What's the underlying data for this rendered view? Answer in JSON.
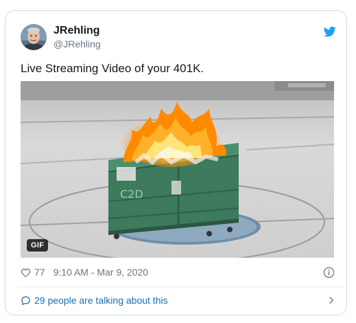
{
  "tweet": {
    "author": {
      "display_name": "JRehling",
      "handle": "@JRehling",
      "avatar_icon": "avatar"
    },
    "text": "Live Streaming Video of your 401K.",
    "media": {
      "type": "gif",
      "badge": "GIF",
      "subject": "dumpster-fire",
      "dumpster_label": "C2D"
    },
    "likes": "77",
    "timestamp": "9:10 AM - Mar 9, 2020",
    "conversation_text": "29 people are talking about this"
  },
  "icons": {
    "brand": "twitter-bird-icon",
    "like": "heart-icon",
    "info": "info-icon",
    "conversation": "speech-bubble-icon",
    "chevron": "chevron-right-icon"
  },
  "colors": {
    "brand_blue": "#1da1f2",
    "link_blue": "#1b6fb3",
    "secondary_text": "#657786",
    "border": "#cfd9de",
    "dumpster_green": "#3e7a5c"
  }
}
